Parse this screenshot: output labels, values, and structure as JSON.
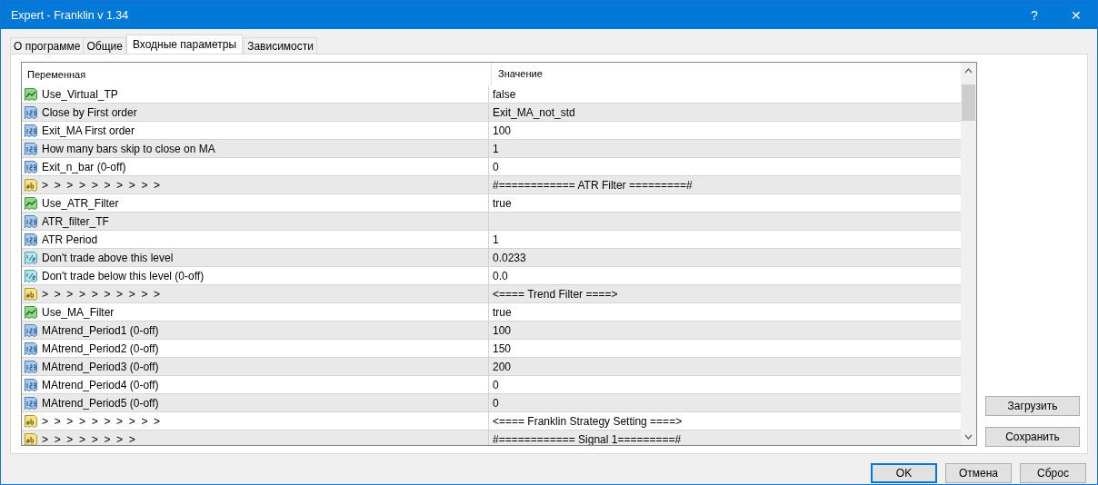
{
  "window": {
    "title": "Expert - Franklin v 1.34",
    "help": "?",
    "close": "✕"
  },
  "tabs": [
    {
      "label": "О программе",
      "selected": false
    },
    {
      "label": "Общие",
      "selected": false
    },
    {
      "label": "Входные параметры",
      "selected": true
    },
    {
      "label": "Зависимости",
      "selected": false
    }
  ],
  "table": {
    "columns": [
      "Переменная",
      "Значение"
    ],
    "rows": [
      {
        "kind": "bool",
        "name": "Use_Virtual_TP",
        "value": "false"
      },
      {
        "kind": "int",
        "name": "Close by First order",
        "value": "Exit_MA_not_std"
      },
      {
        "kind": "int",
        "name": "Exit_MA First order",
        "value": "100"
      },
      {
        "kind": "int",
        "name": "How many bars skip to close on MA",
        "value": "1"
      },
      {
        "kind": "int",
        "name": "Exit_n_bar (0-off)",
        "value": "0"
      },
      {
        "kind": "string",
        "name": ">  >  >  >  >  >  >  >  >  >",
        "value": "#============ ATR Filter =========#"
      },
      {
        "kind": "bool",
        "name": "Use_ATR_Filter",
        "value": "true"
      },
      {
        "kind": "int",
        "name": "ATR_filter_TF"
      },
      {
        "kind": "int",
        "name": "ATR Period",
        "value": "1"
      },
      {
        "kind": "double",
        "name": "Don't trade above this level",
        "value": "0.0233"
      },
      {
        "kind": "double",
        "name": "Don't trade below this level (0-off)",
        "value": "0.0"
      },
      {
        "kind": "string",
        "name": ">  >  >  >  >  >  >  >  >  >",
        "value": "<==== Trend Filter ====>"
      },
      {
        "kind": "bool",
        "name": "Use_MA_Filter",
        "value": "true"
      },
      {
        "kind": "int",
        "name": "MAtrend_Period1 (0-off)",
        "value": "100"
      },
      {
        "kind": "int",
        "name": "MAtrend_Period2 (0-off)",
        "value": "150"
      },
      {
        "kind": "int",
        "name": "MAtrend_Period3 (0-off)",
        "value": "200"
      },
      {
        "kind": "int",
        "name": "MAtrend_Period4 (0-off)",
        "value": "0"
      },
      {
        "kind": "int",
        "name": "MAtrend_Period5 (0-off)",
        "value": "0"
      },
      {
        "kind": "string",
        "name": ">  >  >  >  >  >  >  >  >  >",
        "value": "<==== Franklin Strategy Setting ====>"
      },
      {
        "kind": "string",
        "name": ">  >  >  >  >  >  >  >",
        "value": "#============ Signal 1=========#"
      }
    ]
  },
  "side_buttons": [
    "Загрузить",
    "Сохранить"
  ],
  "buttons": [
    {
      "label": "OK",
      "default": true
    },
    {
      "label": "Отмена",
      "default": false
    },
    {
      "label": "Сброс",
      "default": false
    }
  ]
}
